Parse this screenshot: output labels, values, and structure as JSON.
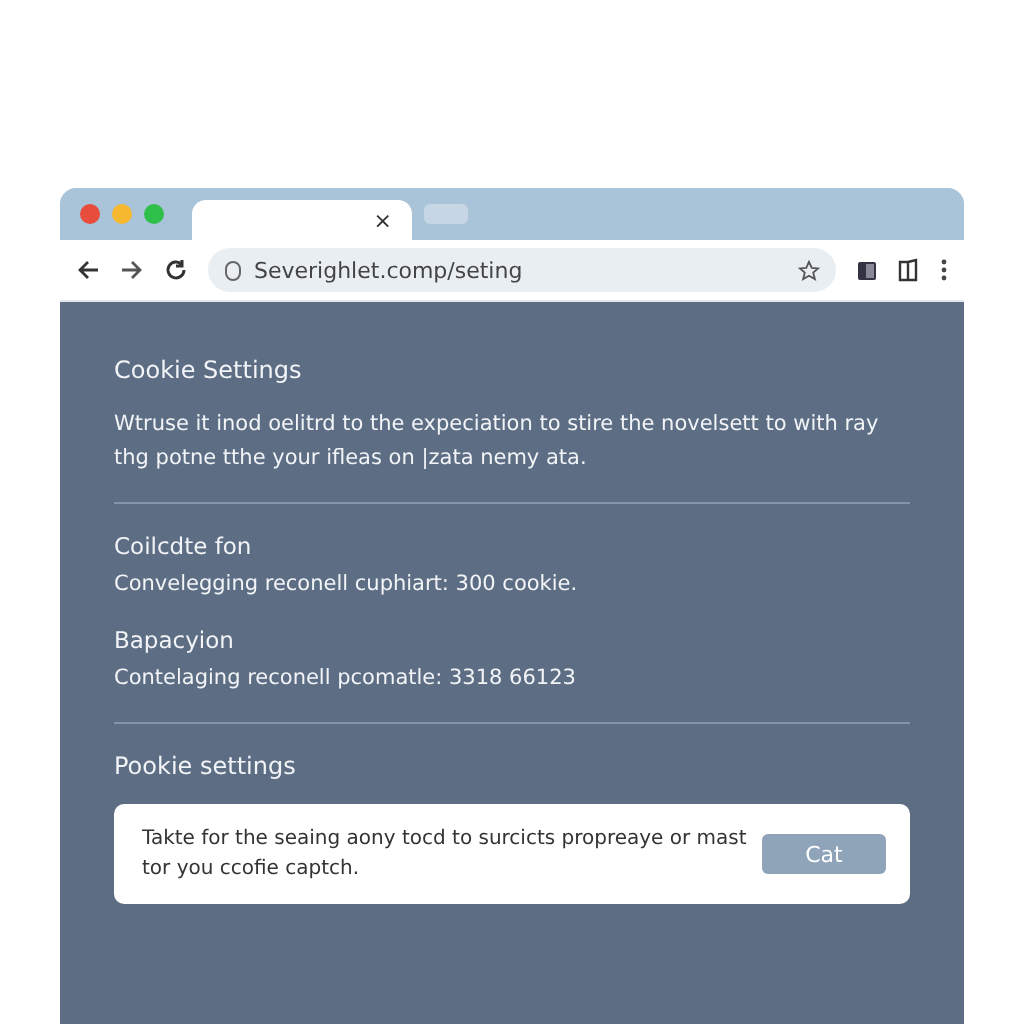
{
  "browser": {
    "tab_close": "×",
    "address": "Severighlet.comp/seting"
  },
  "page": {
    "title": "Cookie Settings",
    "description": "Wtruse it inod oelitrd to the expeciation to stire the novelsett to with ray thg potne tthe your ifleas on |zata nemy ata.",
    "sections": [
      {
        "title": "Coilcdte fon",
        "text": "Convelegging reconell cuphiart: 300 cookie."
      },
      {
        "title": "Bapacyion",
        "text": "Contelaging reconell pcomatle: 3318 66123"
      }
    ],
    "subtitle": "Pookie settings",
    "banner": {
      "text": "Takte for the seaing aony tocd to surcicts propreaye or mast tor you ccofie captch.",
      "button": "Cat"
    }
  }
}
